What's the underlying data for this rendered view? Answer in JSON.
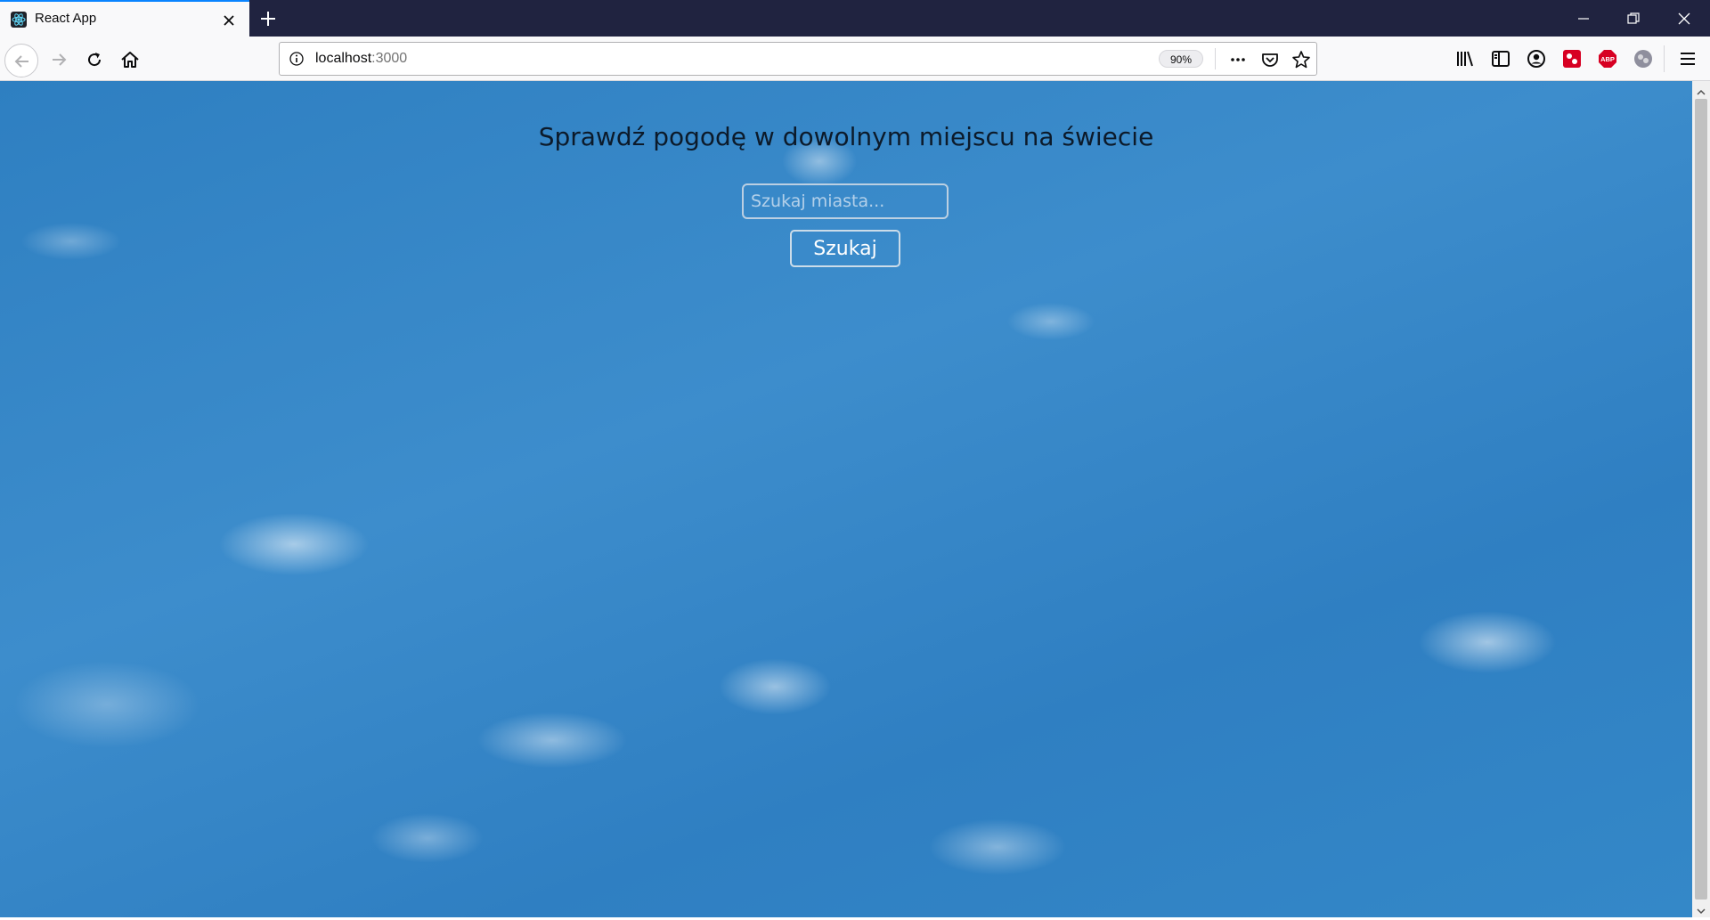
{
  "browser": {
    "tab": {
      "title": "React App"
    },
    "address_bar": {
      "host": "localhost",
      "port": ":3000"
    },
    "zoom": "90%"
  },
  "icons": {
    "favicon": "react-icon",
    "tab_close": "close-icon",
    "new_tab": "plus-icon",
    "back": "arrow-left-icon",
    "forward": "arrow-right-icon",
    "reload": "reload-icon",
    "home": "home-icon",
    "info": "info-icon",
    "more": "more-icon",
    "pocket": "pocket-icon",
    "bookmark": "star-icon",
    "library": "library-icon",
    "sidebar": "sidebar-icon",
    "account": "account-icon",
    "abp": "abp-icon",
    "menu": "hamburger-icon"
  },
  "page": {
    "title": "Sprawdź pogodę w dowolnym miejscu na świecie",
    "search": {
      "placeholder": "Szukaj miasta...",
      "value": ""
    },
    "button_label": "Szukaj"
  },
  "colors": {
    "tabstrip": "#202340",
    "accent": "#0a84ff",
    "sky": "#3488c8"
  }
}
